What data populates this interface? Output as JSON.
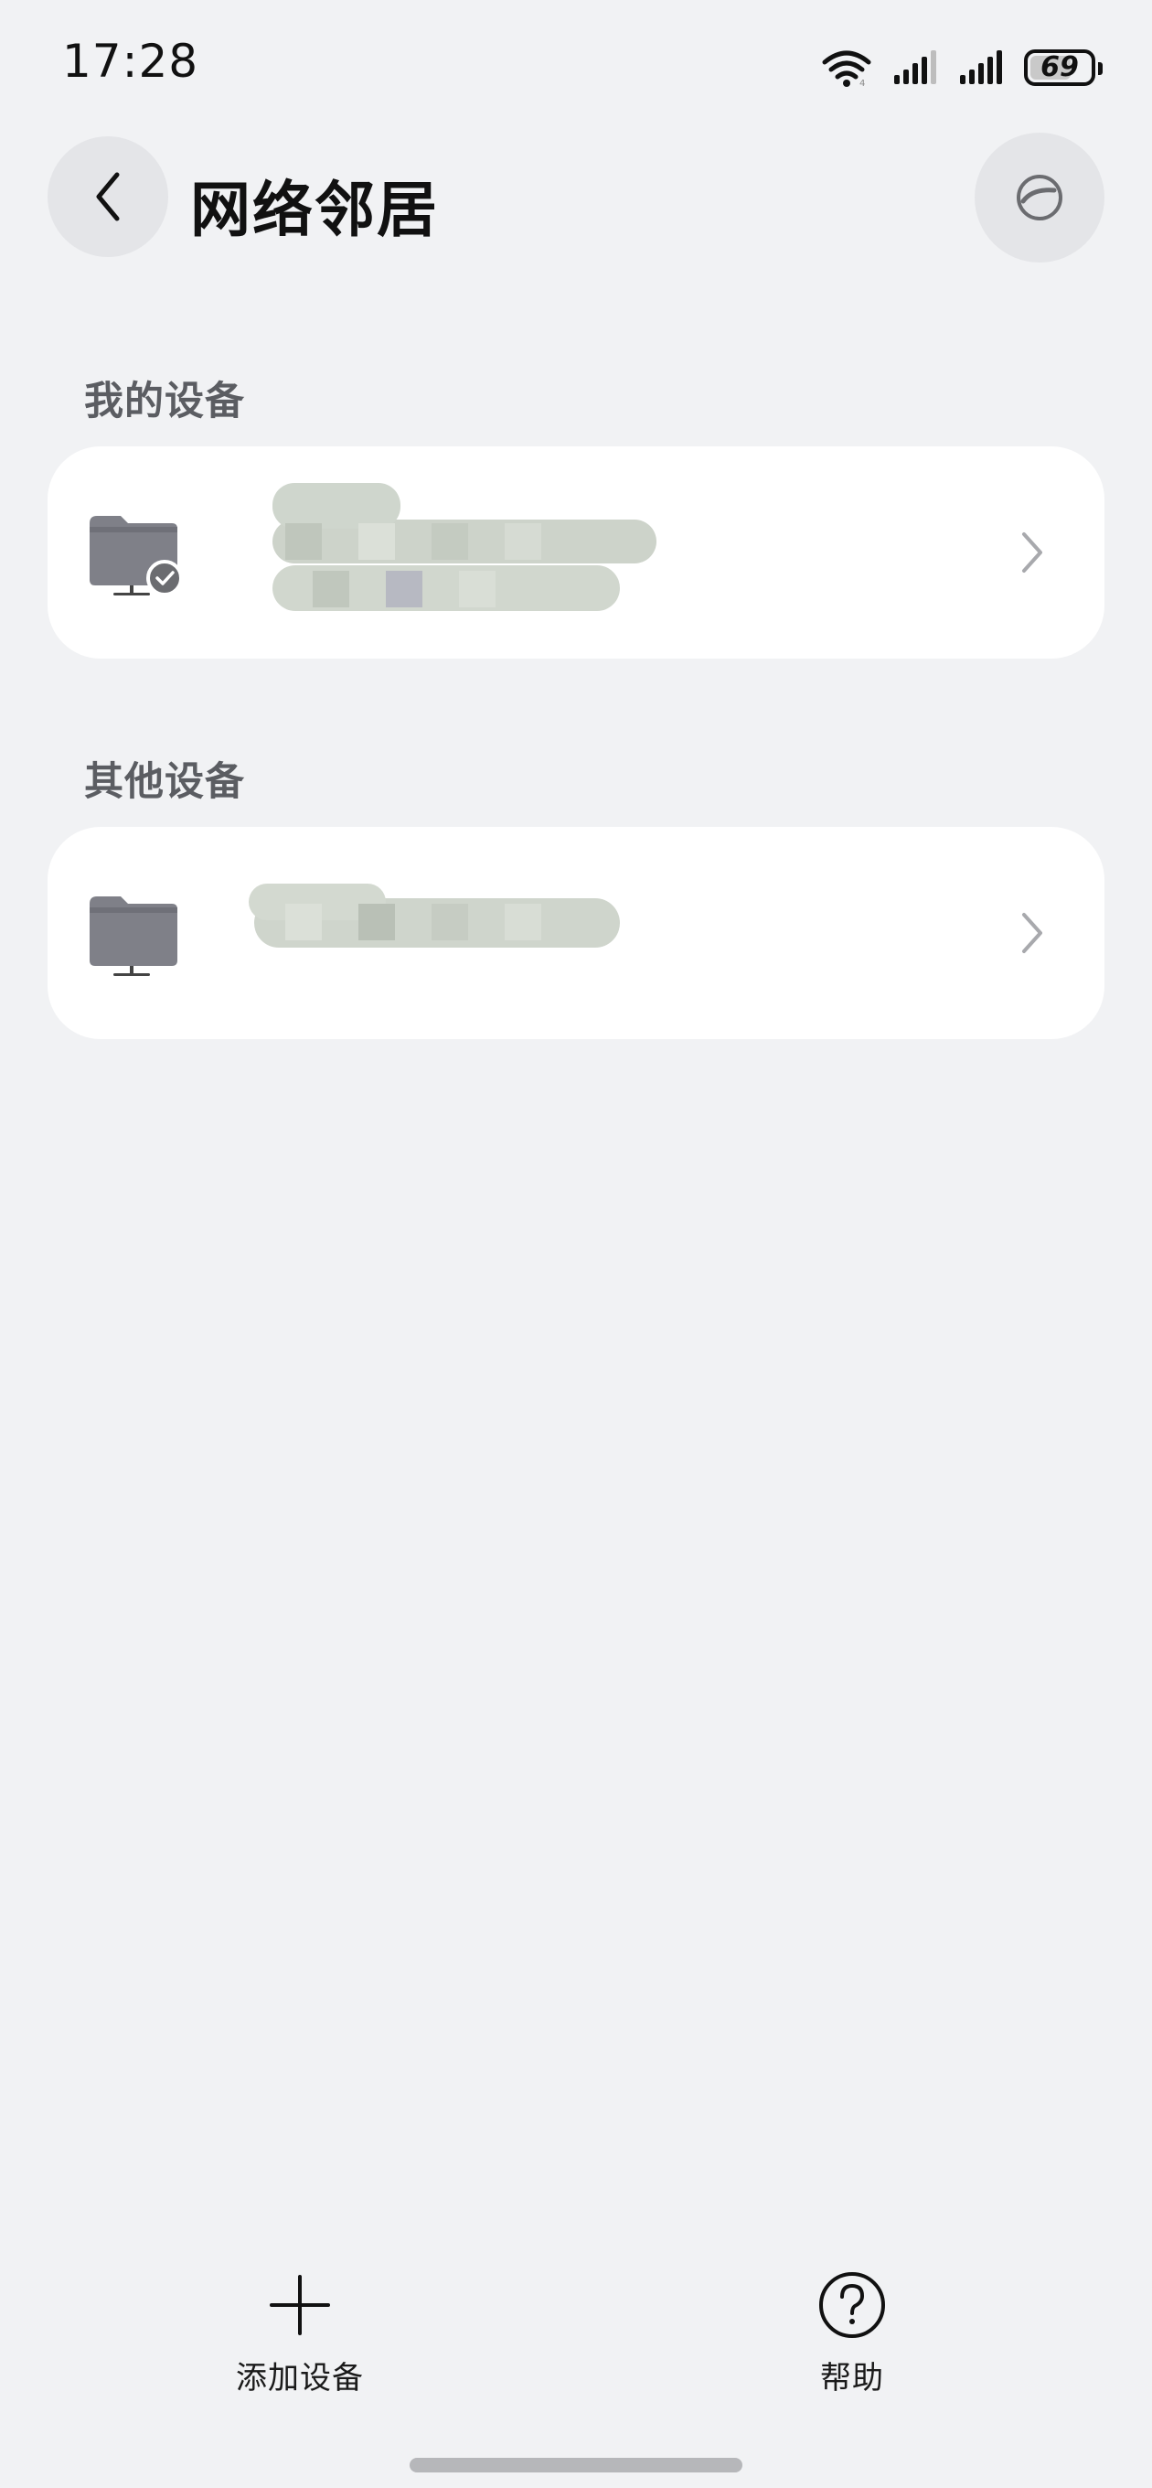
{
  "status_bar": {
    "time": "17:28",
    "battery_level": "69",
    "battery_fraction": 0.69,
    "icons": [
      "wifi-icon",
      "signal-icon",
      "signal-icon",
      "battery-icon"
    ]
  },
  "header": {
    "title": "网络邻居",
    "back_icon": "chevron-left-icon",
    "more_icon": "sweep-icon"
  },
  "sections": [
    {
      "label": "我的设备",
      "devices": [
        {
          "icon": "folder-monitor-icon",
          "connected": true,
          "name": ""
        }
      ]
    },
    {
      "label": "其他设备",
      "devices": [
        {
          "icon": "folder-monitor-icon",
          "connected": false,
          "name": ""
        }
      ]
    }
  ],
  "bottom_bar": {
    "add_device_label": "添加设备",
    "help_label": "帮助"
  },
  "colors": {
    "background": "#f1f2f4",
    "card": "#ffffff",
    "section_label": "#5b5d62",
    "folder": "#7f8088",
    "folder_tab": "#6f7078",
    "chevron": "#a8a9ad"
  }
}
